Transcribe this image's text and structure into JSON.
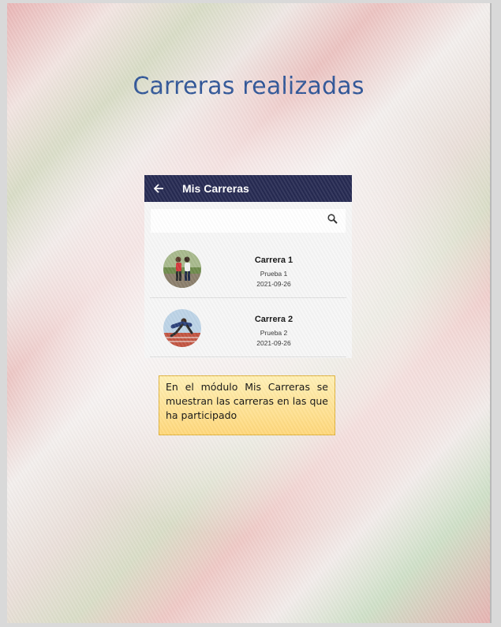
{
  "document": {
    "title": "Carreras realizadas",
    "note": "En el módulo Mis Carreras se muestran las carreras en las que ha participado"
  },
  "app": {
    "title": "Mis Carreras",
    "search_placeholder": "",
    "colors": {
      "appbar": "#262a52",
      "list_background": "#f6f6f6"
    },
    "items": [
      {
        "title": "Carrera 1",
        "subtitle": "Prueba 1",
        "date": "2021-09-26"
      },
      {
        "title": "Carrera 2",
        "subtitle": "Prueba 2",
        "date": "2021-09-26"
      }
    ]
  }
}
